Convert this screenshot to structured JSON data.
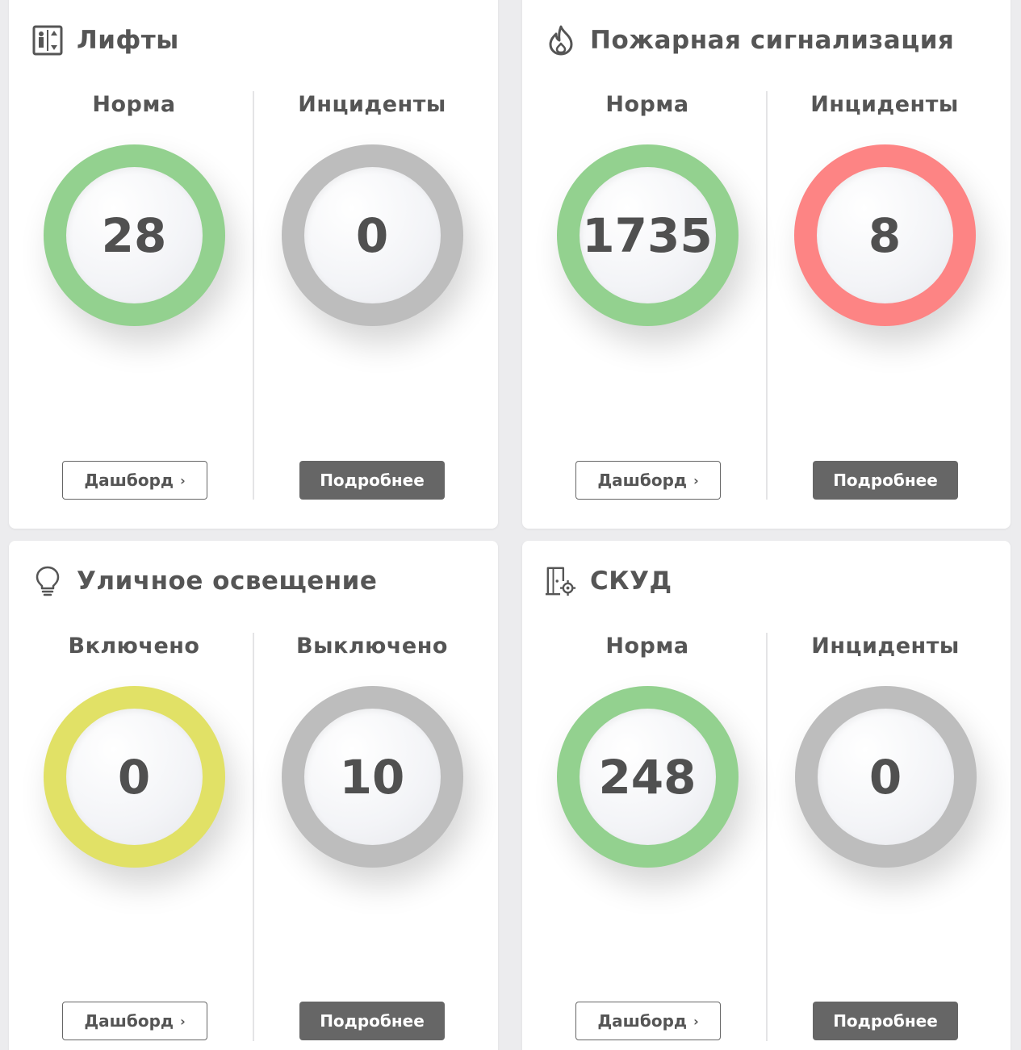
{
  "colors": {
    "green": "#93d18f",
    "gray": "#bdbdbd",
    "red": "#fd8484",
    "yellow": "#e1e166",
    "text": "#555555",
    "button_dark": "#666666"
  },
  "cards": [
    {
      "title": "Лифты",
      "icon": "elevator-icon",
      "left": {
        "label": "Норма",
        "value": "28",
        "color": "green"
      },
      "right": {
        "label": "Инциденты",
        "value": "0",
        "color": "gray"
      },
      "dashboard_label": "Дашборд",
      "details_label": "Подробнее"
    },
    {
      "title": "Пожарная сигнализация",
      "icon": "fire-icon",
      "left": {
        "label": "Норма",
        "value": "1735",
        "color": "green"
      },
      "right": {
        "label": "Инциденты",
        "value": "8",
        "color": "red"
      },
      "dashboard_label": "Дашборд",
      "details_label": "Подробнее"
    },
    {
      "title": "Уличное освещение",
      "icon": "lightbulb-icon",
      "left": {
        "label": "Включено",
        "value": "0",
        "color": "yellow"
      },
      "right": {
        "label": "Выключено",
        "value": "10",
        "color": "gray"
      },
      "dashboard_label": "Дашборд",
      "details_label": "Подробнее"
    },
    {
      "title": "СКУД",
      "icon": "access-control-icon",
      "left": {
        "label": "Норма",
        "value": "248",
        "color": "green"
      },
      "right": {
        "label": "Инциденты",
        "value": "0",
        "color": "gray"
      },
      "dashboard_label": "Дашборд",
      "details_label": "Подробнее"
    }
  ]
}
